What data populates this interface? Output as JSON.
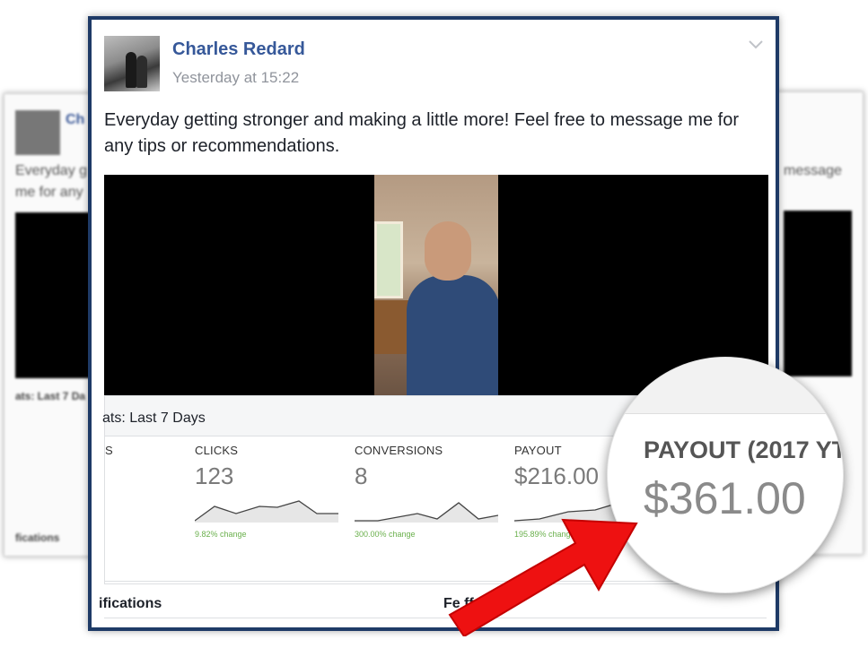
{
  "background_cards": {
    "left": {
      "name_fragment": "Ch",
      "text_line1": "Everyday g",
      "text_line2": "me for any",
      "stats_fragment": "ats: Last 7 Da",
      "footer_fragment": "fications"
    },
    "right": {
      "text_fragment": "message"
    }
  },
  "post": {
    "author": "Charles Redard",
    "timestamp": "Yesterday at 15:22",
    "text": "Everyday getting stronger and making a little more! Feel free to message me for any tips or recommendations."
  },
  "stats": {
    "title": "ats: Last 7 Days",
    "cut_label": "S",
    "metrics": [
      {
        "label": "CLICKS",
        "value": "123",
        "change": "9.82% change"
      },
      {
        "label": "CONVERSIONS",
        "value": "8",
        "change": "300.00% change"
      },
      {
        "label": "PAYOUT",
        "value": "$216.00",
        "change": "195.89% change"
      }
    ]
  },
  "bottom": {
    "left": "ifications",
    "right": "Fe      ffers"
  },
  "zoom": {
    "label": "PAYOUT (2017 YT",
    "value": "$361.00"
  },
  "colors": {
    "card_border": "#1e3a66",
    "author": "#365899",
    "change_green": "#6ab04c",
    "arrow_red": "#ee1111"
  },
  "icons": {
    "post_menu": "chevron-down-icon",
    "arrow": "red-arrow-pointer"
  }
}
